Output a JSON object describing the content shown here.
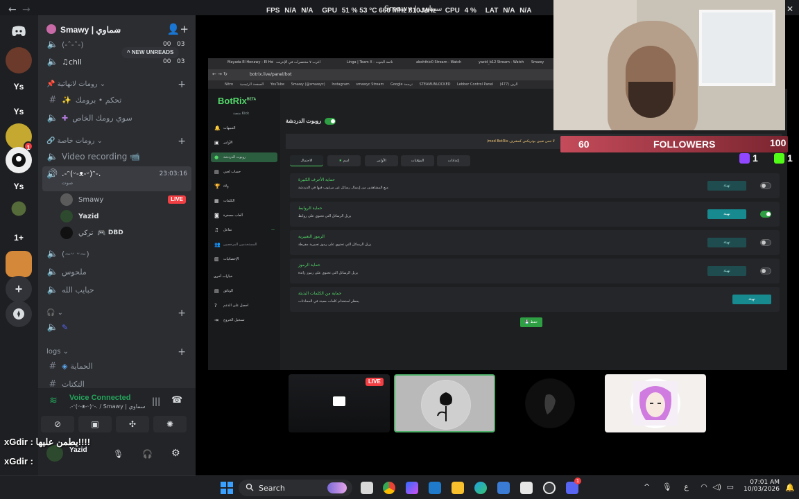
{
  "window": {
    "title": "Smawy | سماوي"
  },
  "overlay_stats": {
    "fps_label": "FPS",
    "fps_value": "N/A",
    "fps_value2": "N/A",
    "gpu_label": "GPU",
    "gpu_value": "51 % 53 °C 660 MHz 810 MHz",
    "cpu_label": "CPU",
    "cpu_value": "4 %",
    "lat_label": "LAT",
    "lat_value": "N/A",
    "lat_value2": "N/A"
  },
  "discord": {
    "server_name": "Smawy | سماوي",
    "new_unreads": "NEW UNREADS",
    "channels": [
      {
        "name": "(-ˆ-ˆ-)",
        "count": "00",
        "count2": "03"
      },
      {
        "name": "♫chll",
        "count": "00",
        "count2": "03"
      }
    ],
    "category_1": "رومات لانهائية",
    "text_channel_1": "تحكم • برومك",
    "text_channel_2": "سوي رومك الخاص",
    "category_2": "رومات خاصة",
    "voice_channel_video": "Video recording 📹",
    "voice_channel_active": ".-ᵔ(ᵕ-ᴥ-ᵕ)ᵔ-.",
    "voice_channel_active_sub": "صوت",
    "voice_channel_timer": "23:03:16",
    "members": [
      {
        "name": "Smawy",
        "live": "LIVE"
      },
      {
        "name": "Yazid"
      },
      {
        "name": "تركي",
        "game": "DBD"
      }
    ],
    "voice_channel_2": "(~ᵕ ᵕ~)",
    "voice_channel_3": "ملحوس",
    "voice_channel_4": "حبايب الله",
    "category_3": "logs",
    "log_channel_1": "الحماية",
    "log_channel_2": "التكتات",
    "rail_text_items": [
      "Ys",
      "Ys",
      "Ys",
      "1+"
    ],
    "rail_badge": "1"
  },
  "voice_panel": {
    "status": "Voice Connected",
    "channel": ".-ᵔ(ᵕ-ᴥ-ᵕ)ᵔ-. / Smawy | سماوي",
    "username": "Yazid",
    "chat_line_1": "xGdir : يطمن عليها!!!!",
    "chat_line_2": "xGdir : "
  },
  "browser": {
    "tabs": [
      "Mayada El Henawy - El Hob",
      "أغرب ٧ مختصرات في الإنترنت",
      "Linga | Team X - قائمة البثوث",
      "abohthic0 Stream - Watch Live",
      "yazid_b12 Stream - Watch Live",
      "Smawy"
    ],
    "url": "botrix.live/panel/bot",
    "bookmarks": [
      "Nitro",
      "الصفحة الرئيسية",
      "YouTube",
      "Smawy (@smawyc)",
      "Instagram",
      "smawyc Stream",
      "Google ترجمة",
      "STEAMUNLOCKED",
      "Lebber Control Panel",
      "(477) الرف"
    ]
  },
  "botrix": {
    "logo": "BotRix",
    "logo_beta": "BETA",
    "subtitle": "منصة Kick",
    "nav": [
      "التنبيهات",
      "الأوامر",
      "روبوت الدردشة",
      "حساب لعبي",
      "ولاء",
      "الكلمات",
      "ألعاب مصغرة",
      "تفاعل",
      "المستخدمين المرخصين",
      "الإحصائيات"
    ],
    "nav_more_header": "خيارات أخرى",
    "nav_more": [
      "الوثائق",
      "احصل على الدعم",
      "تسجيل الخروج"
    ],
    "page_title": "روبوت الدردشة",
    "banner": "/mod BotRix لا تنس تعيين بوتريكس كمشرف",
    "tabs": [
      "الاحتمال",
      "اسم",
      "الأوامر",
      "المؤقتات",
      "إعدادات"
    ],
    "rows": [
      {
        "title": "حماية الأحرف الكبيرة",
        "desc": "منع المشاهدين من إرسال رسائل غير مرغوب فيها في الدردشة",
        "button": "تهيئة",
        "toggle": false
      },
      {
        "title": "حماية الروابط",
        "desc": "يزيل الرسائل التي تحتوي على روابط",
        "button": "تهيئة",
        "toggle": true
      },
      {
        "title": "الرموز التعبيرية",
        "desc": "يزيل الرسائل التي تحتوي على رموز تعبيرية مفرطة",
        "button": "تهيئة",
        "toggle": false
      },
      {
        "title": "حماية الرموز",
        "desc": "يزيل الرسائل التي تحتوي على رموز زائدة",
        "button": "تهيئة",
        "toggle": false
      },
      {
        "title": "حماية من الكلمات البذيئة",
        "desc": "يحظر استخدام كلمات معينة في المحادثات",
        "button": "تهيئة"
      }
    ],
    "save": "حفظ"
  },
  "followers": {
    "count": "60",
    "label": "FOLLOWERS",
    "goal": "100",
    "twitch_count": "1",
    "kick_count": "1"
  },
  "stream_tiles": {
    "live_label": "LIVE"
  },
  "taskbar": {
    "search_label": "Search",
    "tray_lang": "ع",
    "time": "07:01 AM",
    "date": "10/03/2026",
    "discord_badge": "1"
  },
  "colors": {
    "discord_green": "#23a55a",
    "live_red": "#f23f43",
    "botrix_green": "#53d769",
    "followers_red": "#c44b5a"
  }
}
